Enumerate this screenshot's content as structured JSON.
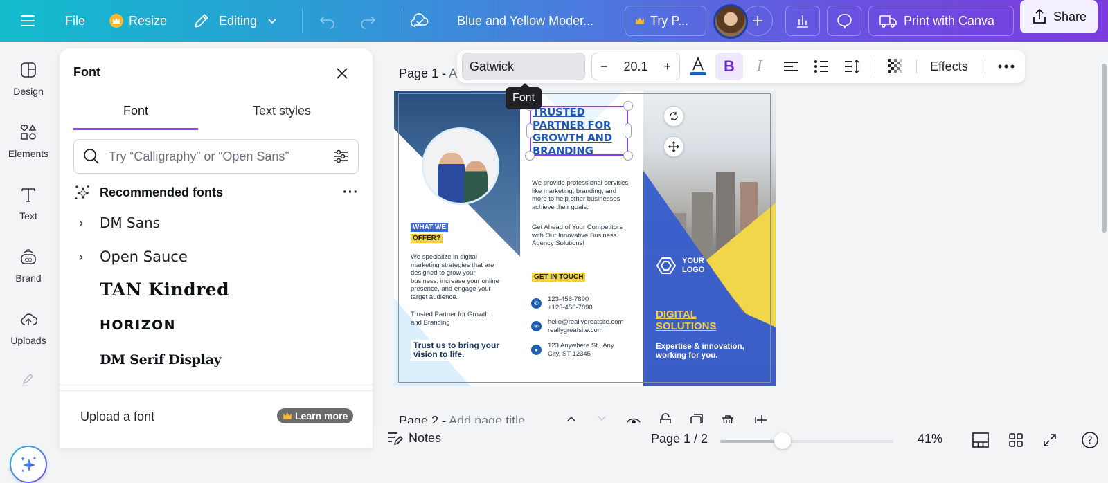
{
  "topbar": {
    "menu_icon": "hamburger-icon",
    "file_label": "File",
    "resize_label": "Resize",
    "editing_label": "Editing",
    "doc_title": "Blue and Yellow Moder...",
    "try_pro_label": "Try P...",
    "print_label": "Print with Canva",
    "share_label": "Share"
  },
  "rail": {
    "items": [
      {
        "label": "Design",
        "icon": "design-icon"
      },
      {
        "label": "Elements",
        "icon": "elements-icon"
      },
      {
        "label": "Text",
        "icon": "text-icon"
      },
      {
        "label": "Brand",
        "icon": "brand-icon"
      },
      {
        "label": "Uploads",
        "icon": "uploads-icon"
      }
    ]
  },
  "font_panel": {
    "title": "Font",
    "tabs": [
      {
        "label": "Font",
        "active": true
      },
      {
        "label": "Text styles",
        "active": false
      }
    ],
    "search_placeholder": "Try “Calligraphy” or “Open Sans”",
    "section_title": "Recommended fonts",
    "fonts": [
      {
        "name": "DM Sans",
        "expandable": true
      },
      {
        "name": "Open Sauce",
        "expandable": true
      },
      {
        "name": "TAN Kindred",
        "expandable": false
      },
      {
        "name": "HORIZON",
        "expandable": false
      },
      {
        "name": "DM Serif Display",
        "expandable": false
      }
    ],
    "upload_label": "Upload a font",
    "learn_more_label": "Learn more"
  },
  "canvas": {
    "page1_label": "Page 1 - ",
    "page1_placeholder": "Ad",
    "page2_label": "Page 2 - ",
    "page2_placeholder": "Add page title"
  },
  "text_toolbar": {
    "font_name": "Gatwick",
    "font_size": "20.1",
    "minus": "−",
    "plus": "+",
    "bold": "B",
    "italic": "I",
    "effects_label": "Effects",
    "text_color": "#1d5fb0",
    "tooltip": "Font"
  },
  "design": {
    "what_we": "WHAT WE",
    "offer": "OFFER?",
    "offer_body": "We specialize in digital marketing strategies that are designed to grow your business, increase your online presence, and engage your target audience.",
    "trusted_small": "Trusted Partner for Growth and Branding",
    "trust_us": "Trust us to bring your vision to life.",
    "headline": "TRUSTED PARTNER FOR GROWTH AND BRANDING",
    "services": "We provide professional services like marketing, branding, and more to help other businesses achieve their goals.",
    "get_ahead": "Get Ahead of Your Competitors with Our Innovative Business Agency Solutions!",
    "get_in_touch": "GET IN TOUCH",
    "phone1": "123-456-7890",
    "phone2": "+123-456-7890",
    "email1": "hello@reallygreatsite.com",
    "email2": "reallygreatsite.com",
    "address1": "123 Anywhere St., Any",
    "address2": "City, ST 12345",
    "logo_line1": "YOUR",
    "logo_line2": "LOGO",
    "digital": "DIGITAL",
    "solutions": "SOLUTIONS",
    "expertise1": "Expertise & innovation,",
    "expertise2": "working for you.",
    "colors": {
      "blue": "#3a65cf",
      "yellow": "#f5d23c",
      "navy": "#1d5fb0"
    }
  },
  "bottombar": {
    "notes_label": "Notes",
    "page_count": "Page 1 / 2",
    "zoom_percent": "41%",
    "zoom_slider_fraction": 0.36
  }
}
